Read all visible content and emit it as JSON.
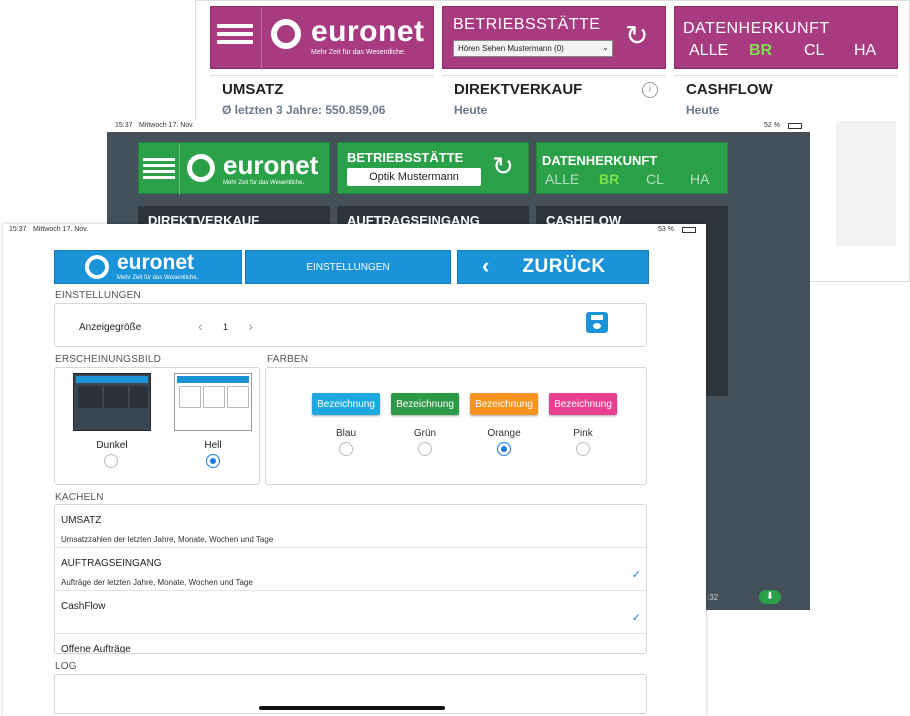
{
  "back_screen": {
    "brand": "euronet",
    "tagline": "Mehr Zeit für das Wesentliche.",
    "betriebsstaette_label": "BETRIEBSSTÄTTE",
    "betriebsstaette_value": "Hören Sehen Mustermann (0)",
    "datenherkunft_label": "DATENHERKUNFT",
    "sources": [
      "ALLE",
      "BR",
      "CL",
      "HA"
    ],
    "tiles": [
      {
        "title": "UMSATZ",
        "sub": "Ø letzten 3 Jahre: 550.859,06"
      },
      {
        "title": "DIREKTVERKAUF",
        "sub": "Heute"
      },
      {
        "title": "CASHFLOW",
        "sub": "Heute"
      }
    ],
    "accent": "#a83a80",
    "active_source_color": "#7be04a"
  },
  "mid_screen": {
    "time": "15:37",
    "date": "Mittwoch 17. Nov.",
    "battery": "52 %",
    "brand": "euronet",
    "tagline": "Mehr Zeit für das Wesentliche.",
    "betriebsstaette_label": "BETRIEBSSTÄTTE",
    "betriebsstaette_value": "Optik Mustermann",
    "datenherkunft_label": "DATENHERKUNFT",
    "sources": [
      "ALLE",
      "BR",
      "CL",
      "HA"
    ],
    "tiles": [
      "DIREKTVERKAUF",
      "AUFTRAGSEINGANG",
      "CASHFLOW"
    ],
    "footer_time": ":32",
    "accent": "#2aa148"
  },
  "front_screen": {
    "time": "15:37",
    "date": "Mittwoch 17. Nov.",
    "battery": "53 %",
    "brand": "euronet",
    "tagline": "Mehr Zeit für das Wesentliche.",
    "einstellungen_button": "EINSTELLUNGEN",
    "back_button": "ZURÜCK",
    "sections": {
      "einstellungen": "EINSTELLUNGEN",
      "erscheinungsbild": "ERSCHEINUNGSBILD",
      "farben": "FARBEN",
      "kacheln": "KACHELN",
      "log": "LOG"
    },
    "anzeigegroesse_label": "Anzeigegröße",
    "anzeigegroesse_value": "1",
    "themes": [
      {
        "label": "Dunkel",
        "selected": false
      },
      {
        "label": "Hell",
        "selected": true
      }
    ],
    "colors": [
      {
        "button": "Bezeichnung",
        "label": "Blau",
        "hex": "#1da8e0",
        "selected": false
      },
      {
        "button": "Bezeichnung",
        "label": "Grün",
        "hex": "#2e9a47",
        "selected": false
      },
      {
        "button": "Bezeichnung",
        "label": "Orange",
        "hex": "#f7941d",
        "selected": true
      },
      {
        "button": "Bezeichnung",
        "label": "Pink",
        "hex": "#e8408f",
        "selected": false
      }
    ],
    "kacheln": [
      {
        "title": "UMSATZ",
        "desc": "Umsatzzahlen der letzten Jahre, Monate, Wochen und Tage",
        "checked": false
      },
      {
        "title": "AUFTRAGSEINGANG",
        "desc": "Aufträge der letzten Jahre, Monate, Wochen und Tage",
        "checked": true
      },
      {
        "title": "CashFlow",
        "desc": "",
        "checked": true
      },
      {
        "title": "Offene Aufträge",
        "desc": "",
        "checked": true
      }
    ],
    "accent": "#1a93d9"
  }
}
